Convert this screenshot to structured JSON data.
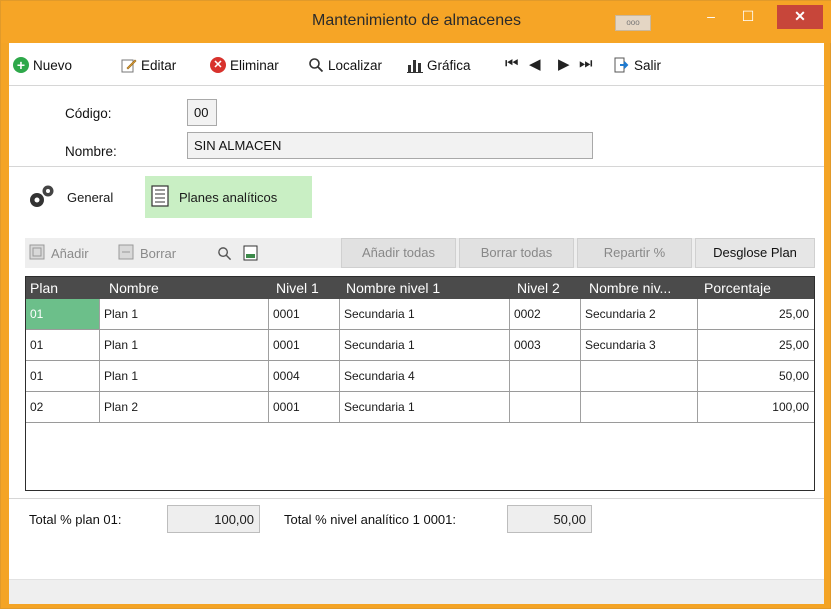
{
  "window": {
    "title": "Mantenimiento de almacenes",
    "extra_button": "ooo",
    "minimize": "–",
    "maximize": "☐",
    "close": "✕"
  },
  "toolbar": {
    "nuevo": "Nuevo",
    "editar": "Editar",
    "eliminar": "Eliminar",
    "localizar": "Localizar",
    "grafica": "Gráfica",
    "salir": "Salir",
    "nav_first": "⏮",
    "nav_prev": "◀",
    "nav_next": "▶",
    "nav_last": "⏭"
  },
  "form": {
    "codigo_label": "Código:",
    "codigo_value": "00",
    "nombre_label": "Nombre:",
    "nombre_value": "SIN ALMACEN"
  },
  "tabs": {
    "general": "General",
    "planes": "Planes analíticos"
  },
  "subtoolbar": {
    "anadir": "Añadir",
    "borrar": "Borrar",
    "anadir_todas": "Añadir todas",
    "borrar_todas": "Borrar todas",
    "repartir": "Repartir %",
    "desglose": "Desglose Plan"
  },
  "grid": {
    "columns": [
      "Plan",
      "Nombre",
      "Nivel 1",
      "Nombre nivel 1",
      "Nivel 2",
      "Nombre niv...",
      "Porcentaje"
    ],
    "rows": [
      [
        "01",
        "Plan 1",
        "0001",
        "Secundaria 1",
        "0002",
        "Secundaria 2",
        "25,00"
      ],
      [
        "01",
        "Plan 1",
        "0001",
        "Secundaria 1",
        "0003",
        "Secundaria 3",
        "25,00"
      ],
      [
        "01",
        "Plan 1",
        "0004",
        "Secundaria 4",
        "",
        "",
        "50,00"
      ],
      [
        "02",
        "Plan 2",
        "0001",
        "Secundaria 1",
        "",
        "",
        "100,00"
      ]
    ]
  },
  "totals": {
    "plan_label": "Total % plan 01:",
    "plan_value": "100,00",
    "nivel_label": "Total % nivel analítico 1 0001:",
    "nivel_value": "50,00"
  },
  "colors": {
    "title_bar": "#f6a526",
    "accent_green": "#6cbf8a",
    "tab_active_bg": "#c9efc4",
    "grid_header": "#4b4b4b",
    "close_button": "#c7463a"
  }
}
